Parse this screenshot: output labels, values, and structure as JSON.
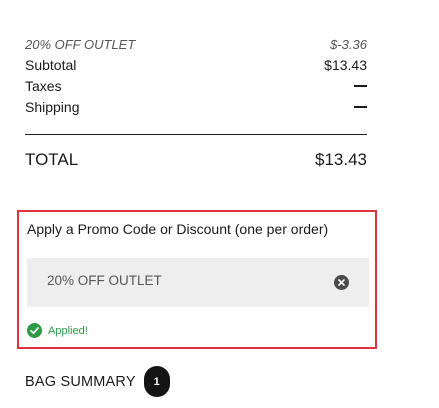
{
  "summary": {
    "discount_label": "20% OFF OUTLET",
    "discount_value": "$-3.36",
    "subtotal_label": "Subtotal",
    "subtotal_value": "$13.43",
    "taxes_label": "Taxes",
    "taxes_value": "—",
    "shipping_label": "Shipping",
    "shipping_value": "—",
    "total_label": "TOTAL",
    "total_value": "$13.43"
  },
  "promo": {
    "title": "Apply a Promo Code or Discount (one per order)",
    "code_value": "20% OFF OUTLET",
    "status": "Applied!",
    "clear_icon": "close-circle-icon",
    "status_icon": "check-circle-icon",
    "highlight_color": "#e0323c",
    "success_color": "#2e9a48"
  },
  "bag": {
    "title": "BAG SUMMARY",
    "count": "1"
  }
}
